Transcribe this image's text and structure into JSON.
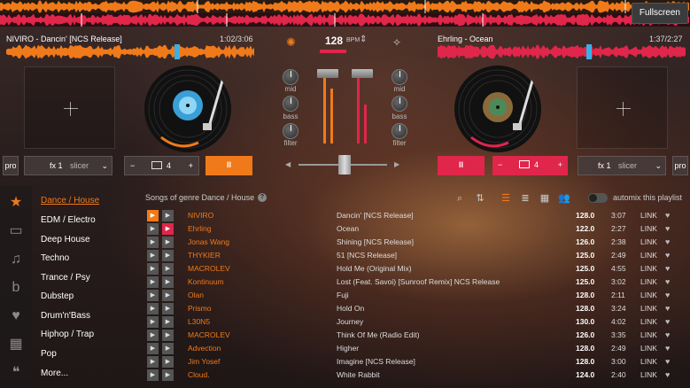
{
  "toolbar": {
    "fullscreen_label": "Fullscreen"
  },
  "deck_left": {
    "track": "NIVIRO - Dancin' [NCS Release]",
    "time": "1:02/3:06",
    "fx_label": "fx 1",
    "fx_select": "slicer",
    "pro_label": "pro",
    "loop_minus": "−",
    "loop_count": "4",
    "loop_plus": "+",
    "play_label": "II"
  },
  "deck_right": {
    "track": "Ehrling - Ocean",
    "time": "1:37/2:27",
    "fx_label": "fx 1",
    "fx_select": "slicer",
    "pro_label": "pro",
    "loop_minus": "−",
    "loop_count": "4",
    "loop_plus": "+",
    "play_label": "II"
  },
  "mixer": {
    "bpm_value": "128",
    "bpm_unit": "BPM",
    "knob_mid": "mid",
    "knob_bass": "bass",
    "knob_filter": "filter"
  },
  "library": {
    "header": "Songs of genre Dance / House",
    "automix_label": "automix this playlist",
    "genres": [
      "Dance / House",
      "EDM / Electro",
      "Deep House",
      "Techno",
      "Trance / Psy",
      "Dubstep",
      "Drum'n'Bass",
      "Hiphop / Trap",
      "Pop",
      "More..."
    ],
    "tracks": [
      {
        "artist": "NIVIRO",
        "title": "Dancin' [NCS Release]",
        "bpm": "128.0",
        "duration": "3:07",
        "link": "LINK"
      },
      {
        "artist": "Ehrling",
        "title": "Ocean",
        "bpm": "122.0",
        "duration": "2:27",
        "link": "LINK"
      },
      {
        "artist": "Jonas Wang",
        "title": "Shining [NCS Release]",
        "bpm": "126.0",
        "duration": "2:38",
        "link": "LINK"
      },
      {
        "artist": "THYKIER",
        "title": "51 [NCS Release]",
        "bpm": "125.0",
        "duration": "2:49",
        "link": "LINK"
      },
      {
        "artist": "MACROLEV",
        "title": "Hold Me (Original Mix)",
        "bpm": "125.0",
        "duration": "4:55",
        "link": "LINK"
      },
      {
        "artist": "Kontinuum",
        "title": "Lost (Feat. Savoi) [Sunroof Remix] NCS Release",
        "bpm": "125.0",
        "duration": "3:02",
        "link": "LINK"
      },
      {
        "artist": "Olan",
        "title": "Fuji",
        "bpm": "128.0",
        "duration": "2:11",
        "link": "LINK"
      },
      {
        "artist": "Prismo",
        "title": "Hold On",
        "bpm": "128.0",
        "duration": "3:24",
        "link": "LINK"
      },
      {
        "artist": "L30N5",
        "title": "Journey",
        "bpm": "130.0",
        "duration": "4:02",
        "link": "LINK"
      },
      {
        "artist": "MACROLEV",
        "title": "Think Of Me (Radio Edit)",
        "bpm": "126.0",
        "duration": "3:35",
        "link": "LINK"
      },
      {
        "artist": "Advection",
        "title": "Higher",
        "bpm": "128.0",
        "duration": "2:49",
        "link": "LINK"
      },
      {
        "artist": "Jim Yosef",
        "title": "Imagine [NCS Release]",
        "bpm": "128.0",
        "duration": "3:00",
        "link": "LINK"
      },
      {
        "artist": "Cloud.",
        "title": "White Rabbit",
        "bpm": "124.0",
        "duration": "2:40",
        "link": "LINK"
      }
    ]
  },
  "colors": {
    "accent_orange": "#f07a1a",
    "accent_red": "#e0264a"
  }
}
